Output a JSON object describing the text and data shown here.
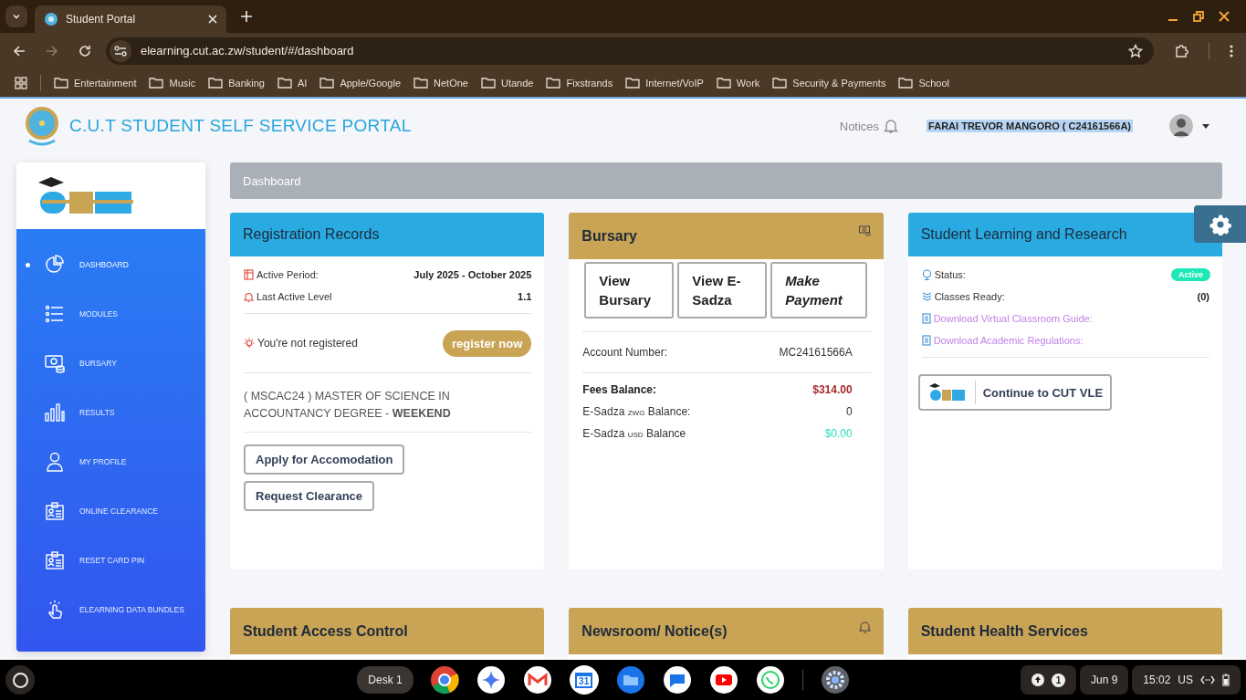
{
  "browser": {
    "tabs": [
      {
        "title": "Student Portal",
        "selected": true
      }
    ],
    "url": "elearning.cut.ac.zw/student/#/dashboard",
    "bookmarks": [
      "Entertainment",
      "Music",
      "Banking",
      "AI",
      "Apple/Google",
      "NetOne",
      "Utande",
      "Fixstrands",
      "Internet/VoIP",
      "Work",
      "Security & Payments",
      "School"
    ]
  },
  "header": {
    "title": "C.U.T STUDENT SELF SERVICE PORTAL",
    "notices": "Notices",
    "user": "FARAI TREVOR MANGORO ( C24161566A)"
  },
  "sidebar": {
    "items": [
      {
        "label": "DASHBOARD",
        "kind": "pie",
        "selected": true
      },
      {
        "label": "MODULES",
        "kind": "list",
        "selected": false
      },
      {
        "label": "BURSARY",
        "kind": "money",
        "selected": false
      },
      {
        "label": "RESULTS",
        "kind": "bars",
        "selected": false
      },
      {
        "label": "MY PROFILE",
        "kind": "person",
        "selected": false
      },
      {
        "label": "ONLINE CLEARANCE",
        "kind": "card",
        "selected": false
      },
      {
        "label": "RESET CARD PIN",
        "kind": "card",
        "selected": false
      },
      {
        "label": "ELEARNING DATA BUNDLES",
        "kind": "hand",
        "selected": false
      }
    ]
  },
  "breadcrumb": "Dashboard",
  "registration": {
    "title": "Registration Records",
    "rows": [
      {
        "kind": "calendar",
        "label": "Active Period:",
        "value": "July 2025 - October 2025"
      },
      {
        "kind": "bell",
        "label": "Last Active Level",
        "value": "1.1"
      }
    ],
    "notice": "You're not registered",
    "register_button": "register now",
    "programme": "( MSCAC24 ) MASTER OF SCIENCE IN ACCOUNTANCY DEGREE - **WEEKEND**",
    "buttons": [
      "Apply for Accomodation",
      "Request Clearance"
    ]
  },
  "bursary": {
    "title": "Bursary",
    "buttons": [
      {
        "label": "View Bursary",
        "emphasis": false
      },
      {
        "label": "View E-Sadza",
        "emphasis": false
      },
      {
        "label": "Make Payment",
        "emphasis": true
      }
    ],
    "rows": [
      {
        "label": "Account Number:",
        "value": "MC24161566A",
        "strong": false,
        "color": "#333333"
      },
      {
        "label": "Fees Balance:",
        "value": "$314.00",
        "strong": true,
        "color": "#a52a2a"
      },
      {
        "label": "E-Sadza",
        "currency": "ZWG",
        "suffix": "Balance:",
        "value": "0",
        "strong": false,
        "color": "#333333"
      },
      {
        "label": "E-Sadza",
        "currency": "USD",
        "suffix": "Balance",
        "value": "$0.00",
        "strong": false,
        "color": "#2ee0c0"
      }
    ]
  },
  "learning": {
    "title": "Student Learning and Research",
    "status_label": "Status:",
    "status": "Active",
    "classes_label": "Classes Ready:",
    "classes": "(0)",
    "links": [
      "Download Virtual Classroom Guide:",
      "Download Academic Regulations:"
    ],
    "vle_button": "Continue to CUT VLE"
  },
  "lower_cards": [
    {
      "title": "Student Access Control",
      "bell": false
    },
    {
      "title": "Newsroom/ Notice(s)",
      "bell": true
    },
    {
      "title": "Student Health Services",
      "bell": false
    }
  ],
  "shelf": {
    "desk": "Desk 1",
    "calendar_day": "31",
    "notifications": "1",
    "date": "Jun 9",
    "time": "15:02",
    "keyboard": "US"
  }
}
